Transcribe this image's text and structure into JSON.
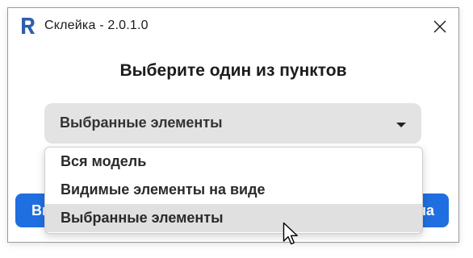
{
  "window": {
    "title": "Склейка - 2.0.1.0",
    "app_icon": "revit-r-icon"
  },
  "dialog": {
    "heading": "Выберите один из пунктов",
    "select": {
      "selected_value": "Выбранные элементы",
      "options": [
        "Вся модель",
        "Видимые элементы на виде",
        "Выбранные элементы"
      ],
      "highlighted_index": 2
    },
    "buttons": {
      "left_partial_label": "Вы",
      "right_partial_label": "на"
    }
  },
  "colors": {
    "accent": "#1f6fe0",
    "select_bg": "#e3e3e3",
    "highlight_bg": "#e0e0e0",
    "app_icon": "#2e5fa8"
  }
}
